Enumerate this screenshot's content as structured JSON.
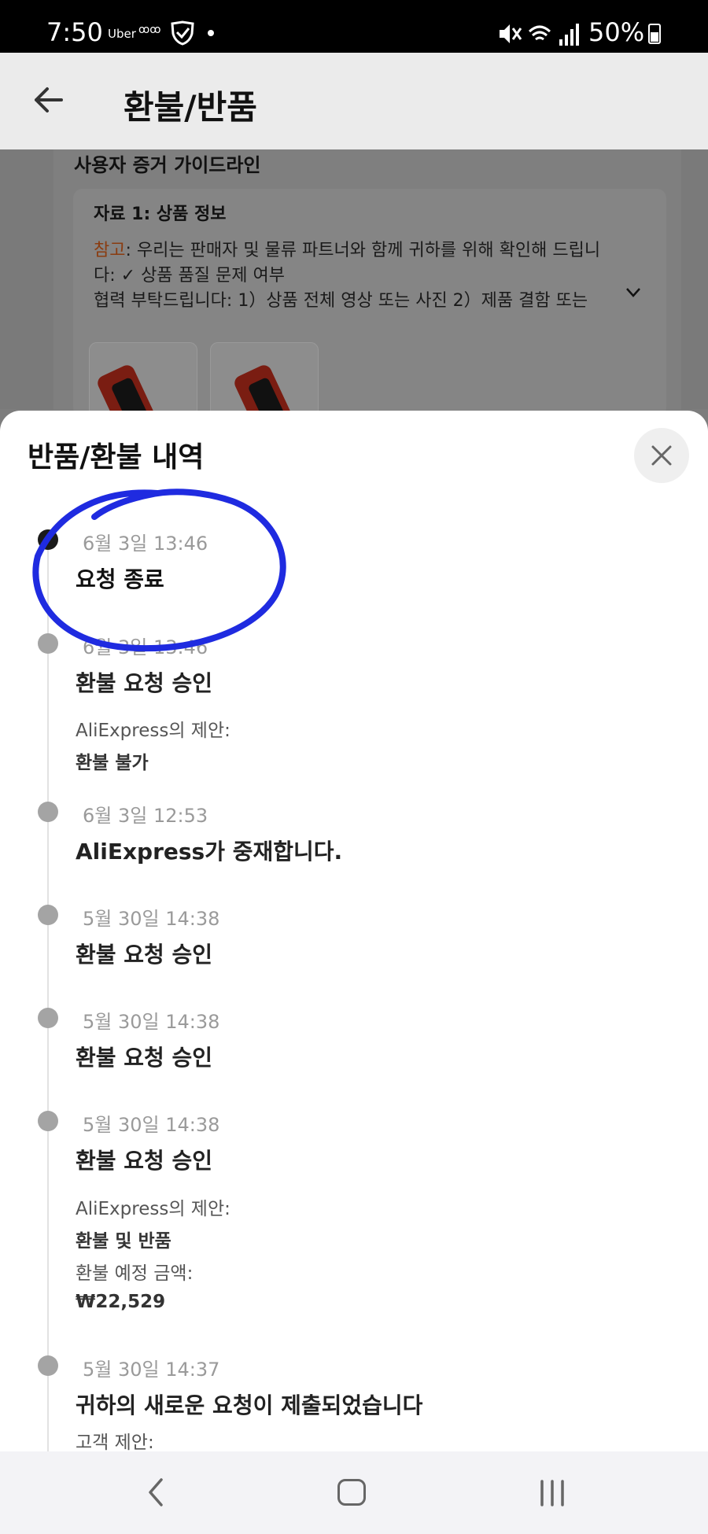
{
  "status_bar": {
    "time": "7:50",
    "app_label": "Uber",
    "app_icon_text": "ꝏꝏ",
    "battery": "50%"
  },
  "header": {
    "title": "환불/반품"
  },
  "background": {
    "heading": "사용자 증거 가이드라인",
    "section_title": "자료 1: 상품 정보",
    "note_label": "참고",
    "line1": ": 우리는 판매자 및 물류 파트너와 함께 귀하를 위해 확인해 드립니",
    "line2": "다: ✓ 상품 품질 문제 여부",
    "line3": "협력 부탁드립니다: 1）상품 전체 영상 또는 사진 2）제품 결함 또는"
  },
  "sheet": {
    "title": "반품/환불 내역",
    "events": [
      {
        "date": "6월 3일 13:46",
        "title": "요청 종료"
      },
      {
        "date": "6월 3일 13:46",
        "title": "환불 요청 승인",
        "sub1": "AliExpress의 제안:",
        "val1": "환불 불가"
      },
      {
        "date": "6월 3일 12:53",
        "title": "AliExpress가 중재합니다."
      },
      {
        "date": "5월 30일 14:38",
        "title": "환불 요청 승인"
      },
      {
        "date": "5월 30일 14:38",
        "title": "환불 요청 승인"
      },
      {
        "date": "5월 30일 14:38",
        "title": "환불 요청 승인",
        "sub1": "AliExpress의 제안:",
        "val1": "환불 및 반품",
        "sub2": "환불 예정 금액:",
        "val2": "₩22,529"
      },
      {
        "date": "5월 30일 14:37",
        "title": "귀하의 새로운 요청이 제출되었습니다",
        "sub1": "고객 제안:"
      }
    ]
  },
  "colors": {
    "annotation": "#1f2be0",
    "note": "#e8602c"
  }
}
